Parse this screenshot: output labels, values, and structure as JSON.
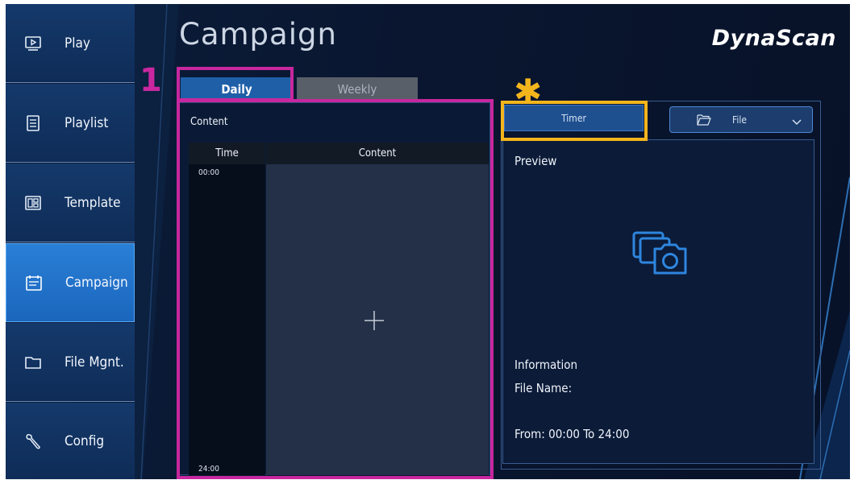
{
  "app": {
    "title": "Campaign",
    "brand": "DynaScan"
  },
  "sidebar": {
    "items": [
      {
        "label": "Play",
        "icon": "play-icon",
        "active": false
      },
      {
        "label": "Playlist",
        "icon": "playlist-icon",
        "active": false
      },
      {
        "label": "Template",
        "icon": "template-icon",
        "active": false
      },
      {
        "label": "Campaign",
        "icon": "campaign-icon",
        "active": true
      },
      {
        "label": "File Mgnt.",
        "icon": "folder-icon",
        "active": false
      },
      {
        "label": "Config",
        "icon": "wrench-icon",
        "active": false
      }
    ]
  },
  "tabs": {
    "daily": "Daily",
    "weekly": "Weekly",
    "selected": "Daily"
  },
  "content_panel": {
    "title": "Content",
    "table": {
      "headers": {
        "time": "Time",
        "content": "Content"
      },
      "time_start": "00:00",
      "time_end": "24:00"
    },
    "add_icon": "plus-icon"
  },
  "right_panel": {
    "timer_label": "Timer",
    "file_label": "File",
    "preview_label": "Preview",
    "preview_icon": "media-camera-icon",
    "information": {
      "heading": "Information",
      "file_name_label": "File Name:",
      "range": "From: 00:00 To 24:00"
    }
  },
  "annotations": {
    "marker_1": "1",
    "marker_star": "✱"
  },
  "colors": {
    "background": "#0a1630",
    "accent": "#2a7fd6",
    "annotation_magenta": "#c8279f",
    "annotation_gold": "#f3b51c"
  }
}
